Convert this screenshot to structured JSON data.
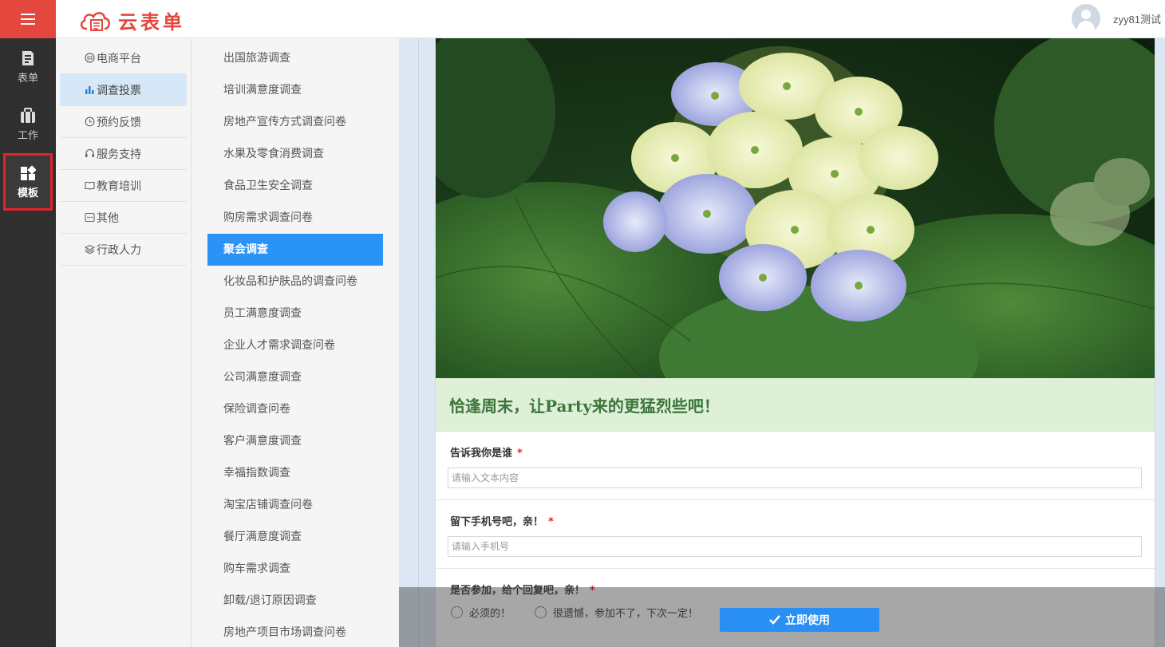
{
  "app": {
    "logo_text": "云表单",
    "brand_color": "#e4473e"
  },
  "user": {
    "name": "zyy81测试"
  },
  "rail": {
    "items": [
      {
        "label": "表单",
        "icon": "form-icon",
        "active": false
      },
      {
        "label": "工作",
        "icon": "briefcase-icon",
        "active": false
      },
      {
        "label": "模板",
        "icon": "template-grid-icon",
        "active": true
      }
    ]
  },
  "categories": [
    {
      "label": "电商平台",
      "icon": "shop-icon",
      "active": false
    },
    {
      "label": "调查投票",
      "icon": "bar-chart-icon",
      "active": true
    },
    {
      "label": "预约反馈",
      "icon": "clock-icon",
      "active": false
    },
    {
      "label": "服务支持",
      "icon": "headset-icon",
      "active": false
    },
    {
      "label": "教育培训",
      "icon": "book-icon",
      "active": false
    },
    {
      "label": "其他",
      "icon": "more-icon",
      "active": false
    },
    {
      "label": "行政人力",
      "icon": "layers-icon",
      "active": false
    }
  ],
  "templates": [
    "出国旅游调查",
    "培训满意度调查",
    "房地产宣传方式调查问卷",
    "水果及零食消费调查",
    "食品卫生安全调查",
    "购房需求调查问卷",
    "聚会调查",
    "化妆品和护肤品的调查问卷",
    "员工满意度调查",
    "企业人才需求调查问卷",
    "公司满意度调查",
    "保险调查问卷",
    "客户满意度调查",
    "幸福指数调查",
    "淘宝店铺调查问卷",
    "餐厅满意度调查",
    "购车需求调查",
    "卸载/退订原因调查",
    "房地产项目市场调查问卷"
  ],
  "active_template_index": 6,
  "preview": {
    "title": "恰逢周末，让Party来的更猛烈些吧！",
    "fields": [
      {
        "label": "告诉我你是谁",
        "required": "*",
        "placeholder": "请输入文本内容"
      },
      {
        "label": "留下手机号吧，亲！",
        "required": "*",
        "placeholder": "请输入手机号"
      }
    ],
    "choice": {
      "label": "是否参加，给个回复吧，亲！",
      "required": "*",
      "options": [
        "必须的！",
        "很遗憾，参加不了，下次一定！"
      ]
    }
  },
  "use_button": {
    "label": "立即使用"
  }
}
